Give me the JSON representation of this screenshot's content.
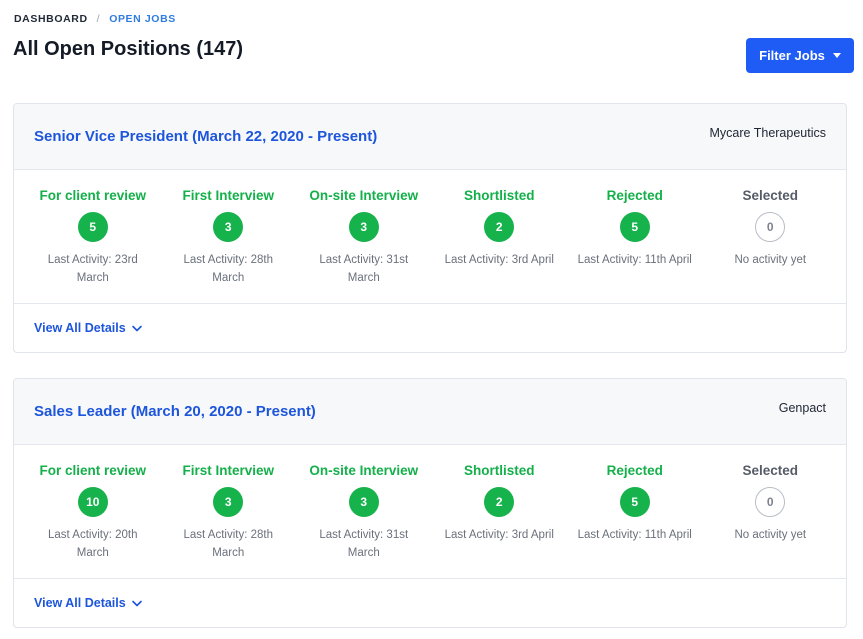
{
  "breadcrumb": {
    "root": "DASHBOARD",
    "separator": "/",
    "current": "OPEN JOBS"
  },
  "page_title": "All Open Positions (147)",
  "filter_button": {
    "label": "Filter Jobs",
    "icon": "caret-down-icon"
  },
  "jobs": [
    {
      "title": "Senior Vice President (March 22, 2020 - Present)",
      "company": "Mycare Therapeutics",
      "stages": [
        {
          "name": "For client review",
          "count": "5",
          "activity": "Last Activity: 23rd March",
          "status": "active"
        },
        {
          "name": "First Interview",
          "count": "3",
          "activity": "Last Activity: 28th March",
          "status": "active"
        },
        {
          "name": "On-site Interview",
          "count": "3",
          "activity": "Last Activity: 31st March",
          "status": "active"
        },
        {
          "name": "Shortlisted",
          "count": "2",
          "activity": "Last Activity: 3rd April",
          "status": "active"
        },
        {
          "name": "Rejected",
          "count": "5",
          "activity": "Last Activity: 11th April",
          "status": "active"
        },
        {
          "name": "Selected",
          "count": "0",
          "activity": "No activity yet",
          "status": "neutral"
        }
      ],
      "details_link": "View All Details"
    },
    {
      "title": "Sales Leader (March 20, 2020 - Present)",
      "company": "Genpact",
      "stages": [
        {
          "name": "For client review",
          "count": "10",
          "activity": "Last Activity: 20th March",
          "status": "active"
        },
        {
          "name": "First Interview",
          "count": "3",
          "activity": "Last Activity: 28th March",
          "status": "active"
        },
        {
          "name": "On-site Interview",
          "count": "3",
          "activity": "Last Activity: 31st March",
          "status": "active"
        },
        {
          "name": "Shortlisted",
          "count": "2",
          "activity": "Last Activity: 3rd April",
          "status": "active"
        },
        {
          "name": "Rejected",
          "count": "5",
          "activity": "Last Activity: 11th April",
          "status": "active"
        },
        {
          "name": "Selected",
          "count": "0",
          "activity": "No activity yet",
          "status": "neutral"
        }
      ],
      "details_link": "View All Details"
    }
  ],
  "colors": {
    "primary": "#1e5cf5",
    "link": "#1d55db",
    "success": "#16b24b",
    "neutral_border": "#b8bdc6"
  }
}
